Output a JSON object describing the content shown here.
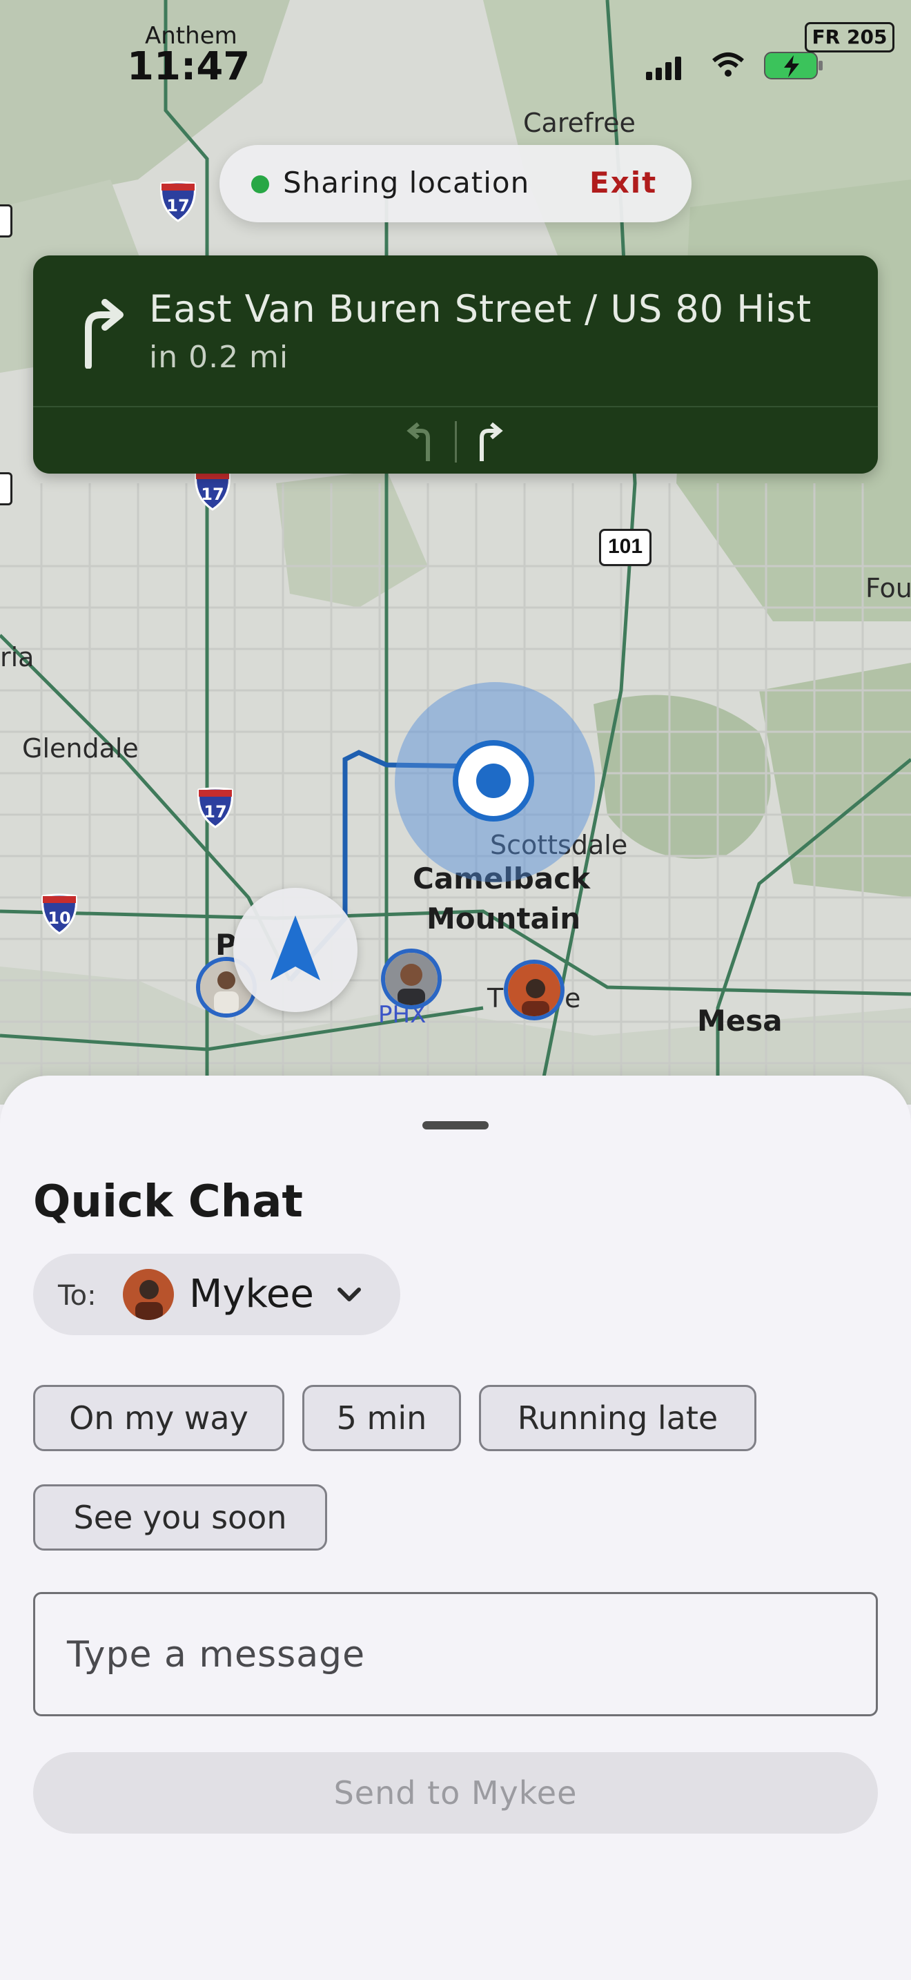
{
  "status_bar": {
    "carrier": "Anthem",
    "time": "11:47",
    "badge": "FR 205"
  },
  "sharing": {
    "text": "Sharing location",
    "exit_label": "Exit",
    "status_color": "#28a745"
  },
  "navigation": {
    "street": "East Van Buren Street / US 80 Hist",
    "distance": "in 0.2 mi",
    "maneuver_icon": "turn-right-icon",
    "lanes": [
      "turn-left-lane-icon",
      "turn-right-lane-icon"
    ]
  },
  "map": {
    "labels": {
      "carefree": "Carefree",
      "glendale": "Glendale",
      "scottsdale": "Scottsdale",
      "camelback": "Camelback",
      "mountain": "Mountain",
      "mesa": "Mesa",
      "phx": "PHX",
      "tempe_t": "T",
      "tempe_e": "e",
      "phoenix_p": "P",
      "four": "Four",
      "ria": "ria"
    },
    "shields": {
      "i17": "17",
      "i10": "10",
      "us101": "101"
    }
  },
  "quick_chat": {
    "title": "Quick Chat",
    "to_label": "To:",
    "recipient": "Mykee",
    "chips": [
      "On my way",
      "5 min",
      "Running late",
      "See you soon"
    ],
    "message_placeholder": "Type a message",
    "send_label": "Send to Mykee"
  }
}
